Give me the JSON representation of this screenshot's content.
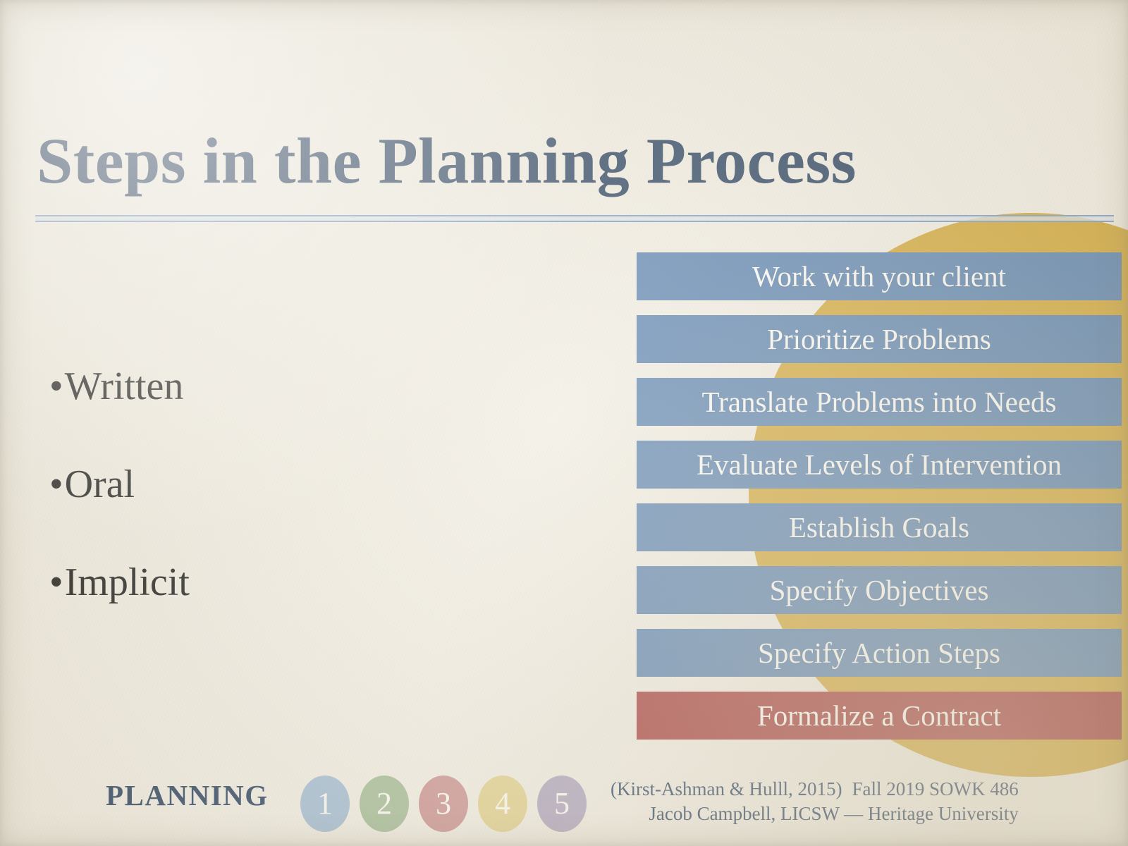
{
  "slide": {
    "title": "Steps in the Planning Process",
    "background_color": "#f2eee3",
    "title_color": "#2b4361",
    "accent_gold": "#d3a838",
    "accent_blue": "#5b83b0",
    "accent_red": "#a53a38"
  },
  "bullets": [
    {
      "bullet": "•",
      "label": "Written"
    },
    {
      "bullet": "•",
      "label": "Oral"
    },
    {
      "bullet": "•",
      "label": "Implicit"
    }
  ],
  "steps": [
    {
      "label": "Work with your client",
      "color": "#5b83b0"
    },
    {
      "label": "Prioritize Problems",
      "color": "#5b83b0"
    },
    {
      "label": "Translate Problems into Needs",
      "color": "#5b83b0"
    },
    {
      "label": "Evaluate Levels of Intervention",
      "color": "#5b83b0"
    },
    {
      "label": "Establish Goals",
      "color": "#5b83b0"
    },
    {
      "label": "Specify Objectives",
      "color": "#5b83b0"
    },
    {
      "label": "Specify Action Steps",
      "color": "#5b83b0"
    },
    {
      "label": "Formalize a Contract",
      "color": "#a53a38"
    }
  ],
  "footer": {
    "brand": "PLANNING",
    "dots": [
      {
        "number": "1",
        "color": "#a4bdd4"
      },
      {
        "number": "2",
        "color": "#a5bd96"
      },
      {
        "number": "3",
        "color": "#cc9492"
      },
      {
        "number": "4",
        "color": "#e3d28d"
      },
      {
        "number": "5",
        "color": "#aea4bd"
      }
    ],
    "citation": "(Kirst-Ashman & Hulll, 2015)",
    "course": "Fall 2019 SOWK 486",
    "author": "Jacob Campbell, LICSW — Heritage University"
  }
}
